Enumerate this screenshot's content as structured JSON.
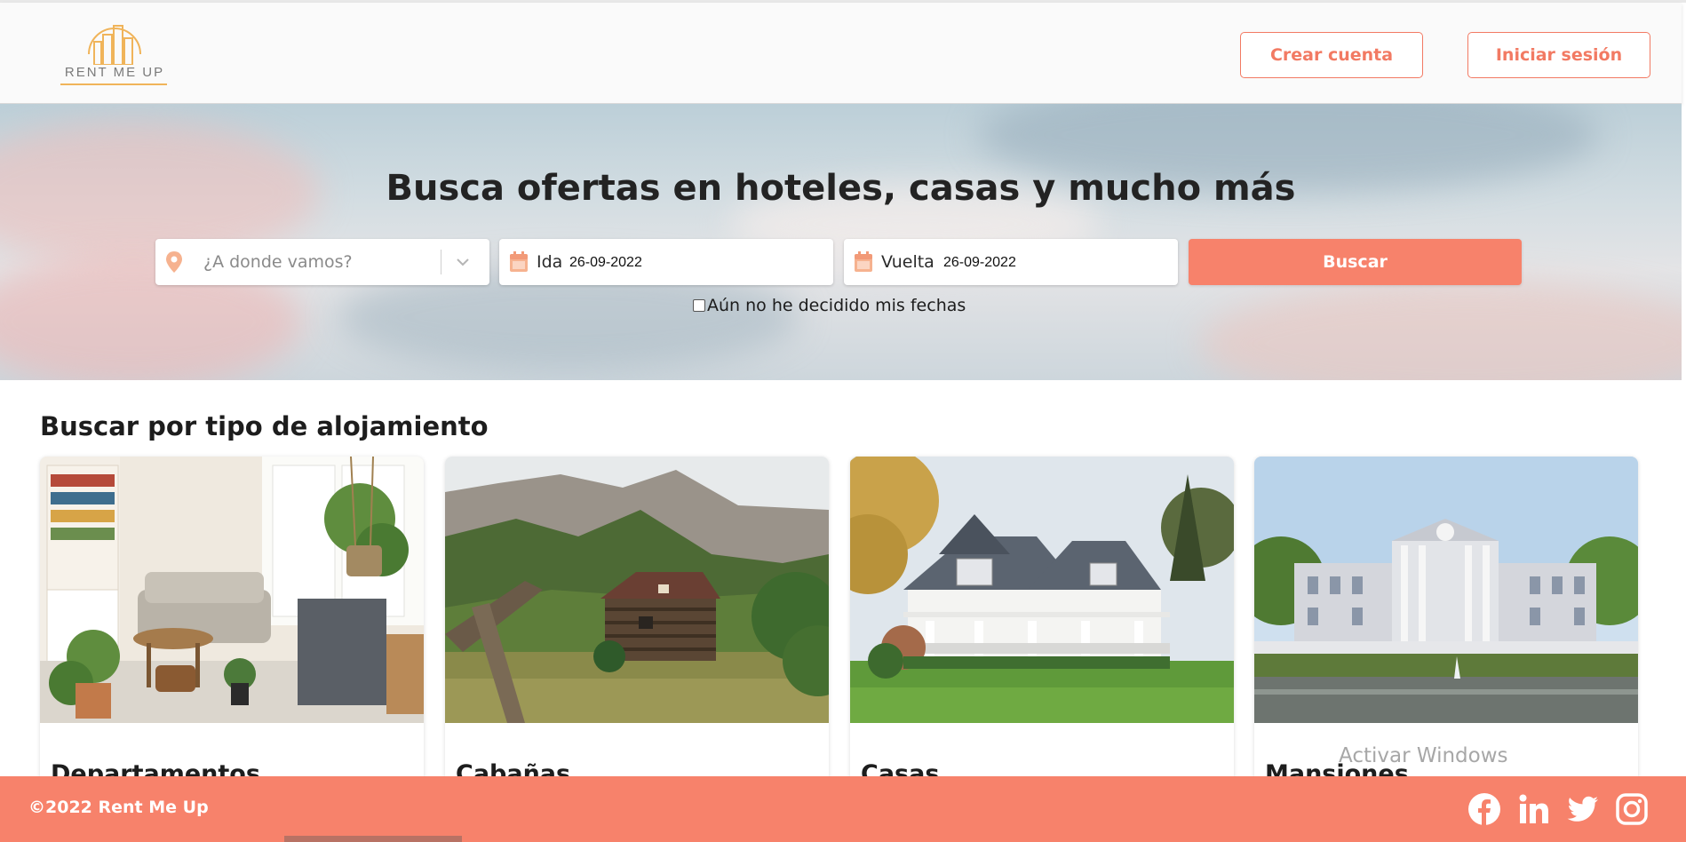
{
  "brand": {
    "logo_text": "RENT ME UP"
  },
  "header": {
    "create_account_label": "Crear cuenta",
    "login_label": "Iniciar sesión"
  },
  "hero": {
    "title": "Busca ofertas en hoteles, casas y mucho más",
    "destination_placeholder": "¿A donde vamos?",
    "ida_label": "Ida",
    "ida_value": "26-09-2022",
    "vuelta_label": "Vuelta",
    "vuelta_value": "26-09-2022",
    "search_button": "Buscar",
    "undecided_label": "Aún no he decidido mis fechas",
    "undecided_checked": false
  },
  "categories": {
    "title": "Buscar por tipo de alojamiento",
    "items": [
      {
        "label": "Departamentos"
      },
      {
        "label": "Cabañas"
      },
      {
        "label": "Casas"
      },
      {
        "label": "Mansiones"
      }
    ]
  },
  "overlay": {
    "watermark": "Activar Windows"
  },
  "footer": {
    "copyright": "©2022 Rent Me Up",
    "social": [
      "facebook-icon",
      "linkedin-icon",
      "twitter-icon",
      "instagram-icon"
    ]
  },
  "colors": {
    "accent": "#f7826b",
    "accent_text": "#f27a63",
    "logo_gold": "#f0b45a"
  }
}
